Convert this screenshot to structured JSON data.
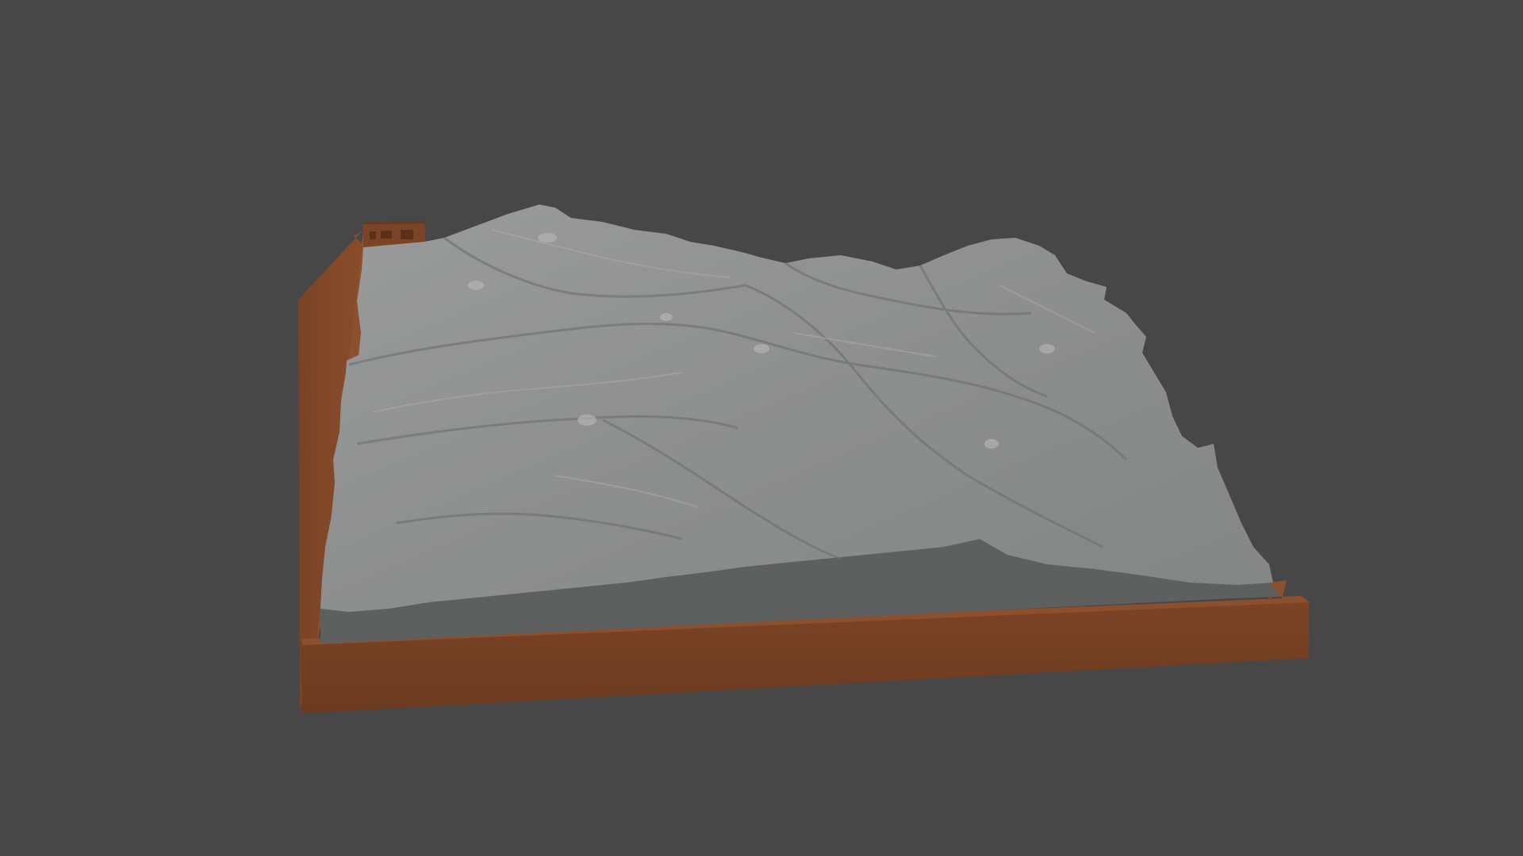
{
  "scene": {
    "background_color": "#474747",
    "subject": "terrain-relief-model",
    "base_color": "#7a4325",
    "terrain_color": "#8f9090",
    "floor_color": "#5d5f5f"
  }
}
